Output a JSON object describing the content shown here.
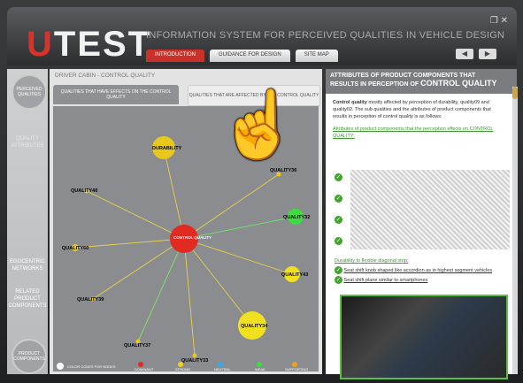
{
  "app": {
    "logo_u": "U",
    "logo_rest": "TEST",
    "tagline": "INFORMATION SYSTEM FOR PERCEIVED QUALITIES IN VEHICLE DESIGN",
    "window_buttons": "❐ ✕"
  },
  "tabs": [
    {
      "label": "INTRODUCTION",
      "active": true
    },
    {
      "label": "GUIDANCE FOR DESIGN",
      "active": false
    },
    {
      "label": "SITE MAP",
      "active": false
    }
  ],
  "nav": {
    "back": "◀",
    "forward": "▶"
  },
  "sidebar": {
    "perceived_qualities": "PERCEIVED QUALITIES",
    "item_quality_attr": "QUALITY ATTRIBUTES",
    "item_egocentric": "EGOCENTRIC NETWORKS",
    "item_related": "RELATED PRODUCT COMPONENTS",
    "item_product_components": "PRODUCT COMPONENTS"
  },
  "center": {
    "title": "DRIVER CABIN - CONTROL QUALITY",
    "subtab1": "QUALITIES THAT HAVE EFFECTS ON THE CONTROL QUALITY",
    "subtab2": "QUALITIES THAT ARE AFFECTED BY THE CONTROL QUALITY",
    "legend_label": "COLOR CODES FOR NODES",
    "legend_items": [
      "DOMINANT",
      "STRONG",
      "NEUTRAL",
      "WEAK",
      "SUPPORTING"
    ],
    "legend_colors": [
      "#e02a22",
      "#f0d020",
      "#33aaf0",
      "#3ddc40",
      "#f0a020"
    ]
  },
  "graph": {
    "center_node": "CONTROL QUALITY",
    "nodes": [
      {
        "label": "DURABILITY",
        "color": "#e8c81c"
      },
      {
        "label": "QUALITY40",
        "color": "#e8c81c"
      },
      {
        "label": "QUALITY60",
        "color": "#e8c81c"
      },
      {
        "label": "QUALITY39",
        "color": "#e8c81c"
      },
      {
        "label": "QUALITY37",
        "color": "#e8c81c"
      },
      {
        "label": "QUALITY32",
        "color": "#3ddc40"
      },
      {
        "label": "QUALITY43",
        "color": "#f0e020"
      },
      {
        "label": "QUALITY34",
        "color": "#f0e020"
      },
      {
        "label": "QUALITY36",
        "color": "#e8c81c"
      },
      {
        "label": "QUALITY33",
        "color": "#e8c81c"
      }
    ]
  },
  "right": {
    "header_line1": "ATTRIBUTES OF PRODUCT COMPONENTS THAT",
    "header_line2": "RESULTS IN PERCEPTION OF",
    "header_big": "CONTROL QUALITY",
    "para_bold": "Control quality",
    "para_text": " mostly affected by perception of durability, quality09 and quality02. The sub qualities and the attributes of product components that results in perception of control quality is as follows:",
    "section1": "Attributes of product components that the perception effects on CONTROL QUALITY:",
    "section2": "Durability to flexible diagonal strip:",
    "item1": "Seat shift knob shaped like accordion as in highest segment vehicles",
    "item2": "Seat shift plane similar to smartphones"
  }
}
